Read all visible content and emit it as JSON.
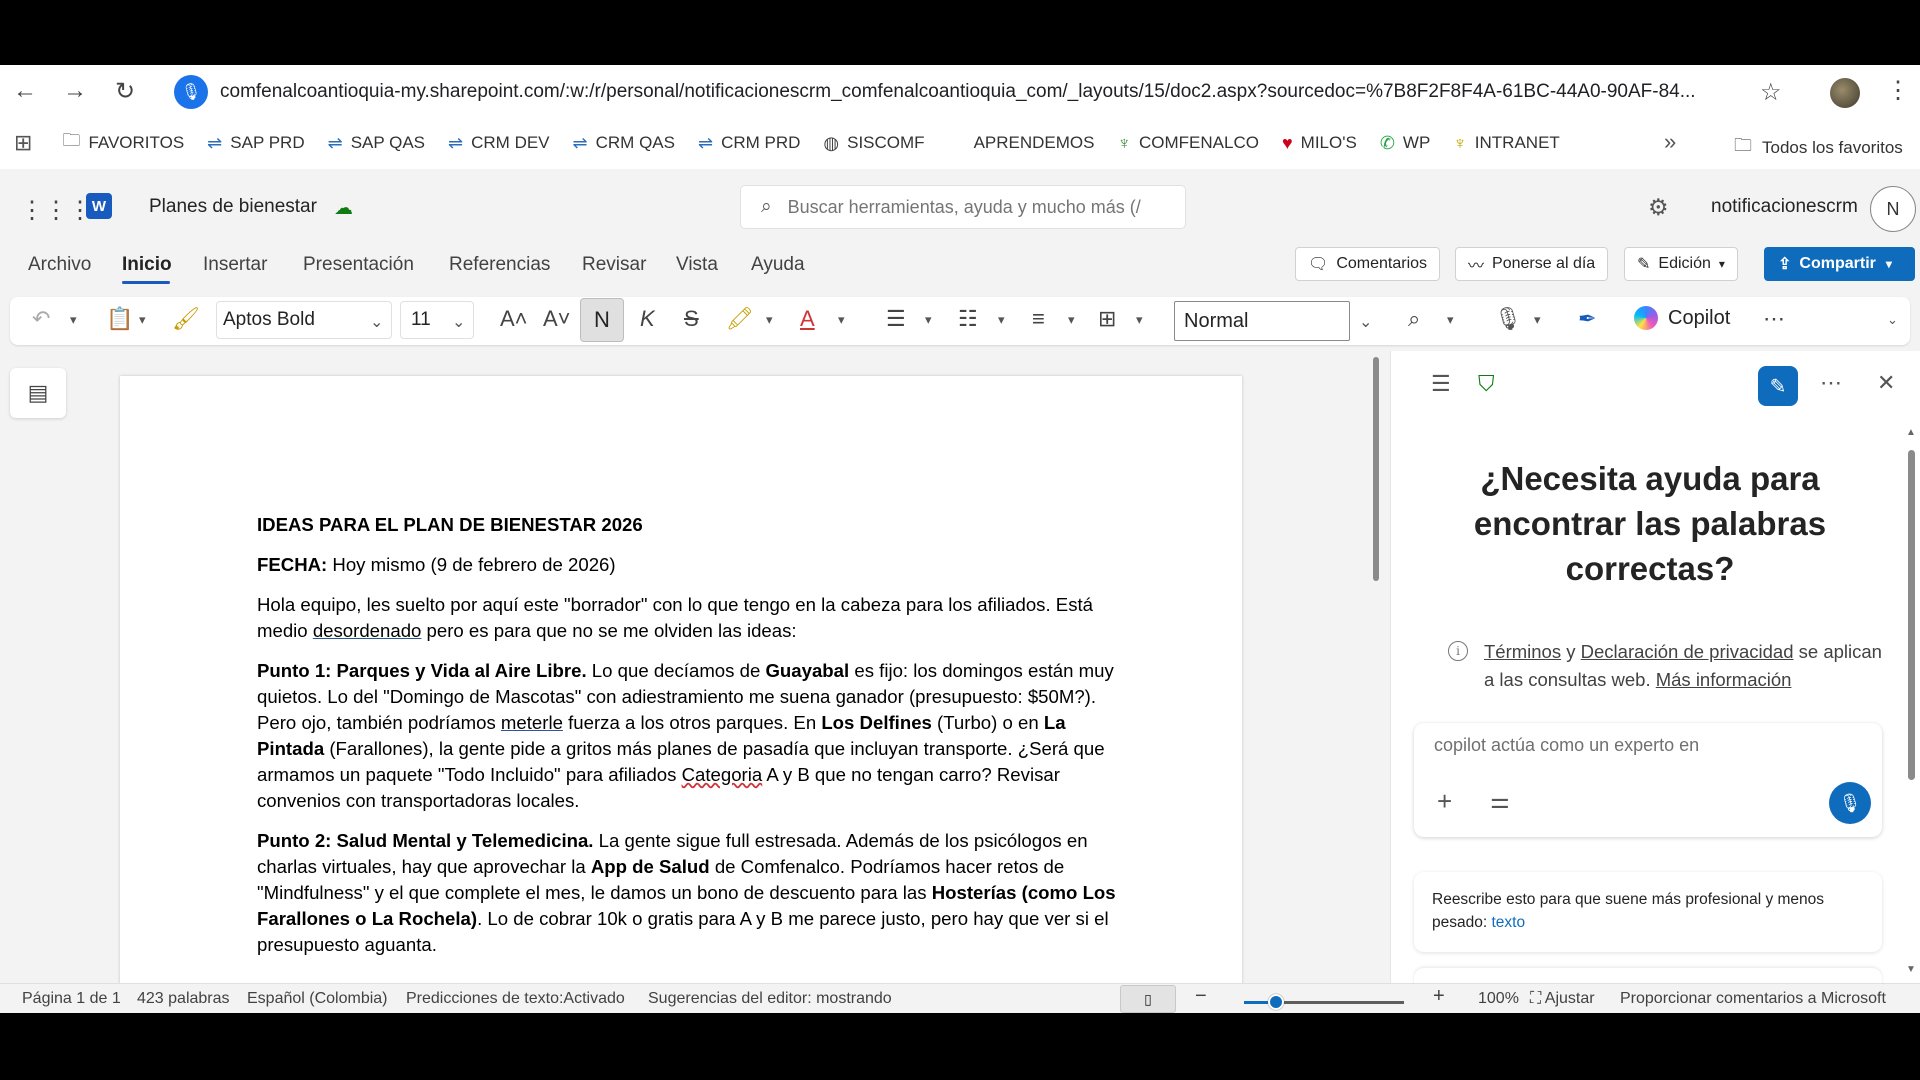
{
  "browser": {
    "url": "comfenalcoantioquia-my.sharepoint.com/:w:/r/personal/notificacionescrm_comfenalcoantioquia_com/_layouts/15/doc2.aspx?sourcedoc=%7B8F2F8F4A-61BC-44A0-90AF-84...",
    "bookmarks": [
      {
        "label": "FAVORITOS",
        "icon": "folder-icon"
      },
      {
        "label": "SAP PRD",
        "icon": "sap-icon"
      },
      {
        "label": "SAP QAS",
        "icon": "sap-icon"
      },
      {
        "label": "CRM DEV",
        "icon": "crm-icon"
      },
      {
        "label": "CRM QAS",
        "icon": "crm-icon"
      },
      {
        "label": "CRM PRD",
        "icon": "crm-icon"
      },
      {
        "label": "SISCOMF",
        "icon": "globe-icon"
      },
      {
        "label": "APRENDEMOS",
        "icon": ""
      },
      {
        "label": "COMFENALCO",
        "icon": "comfenalco-icon"
      },
      {
        "label": "MILO'S",
        "icon": "heart-icon"
      },
      {
        "label": "WP",
        "icon": "whatsapp-icon"
      },
      {
        "label": "INTRANET",
        "icon": "intranet-icon"
      }
    ],
    "all_bookmarks": "Todos los favoritos"
  },
  "word": {
    "doc_title": "Planes de bienestar",
    "search_placeholder": "Buscar herramientas, ayuda y mucho más (/",
    "user": "notificacionescrm",
    "avatar_initial": "N",
    "tabs": [
      "Archivo",
      "Inicio",
      "Insertar",
      "Presentación",
      "Referencias",
      "Revisar",
      "Vista",
      "Ayuda"
    ],
    "active_tab": "Inicio",
    "header_buttons": {
      "comments": "Comentarios",
      "catch_up": "Ponerse al día",
      "editing": "Edición",
      "share": "Compartir"
    },
    "ribbon": {
      "font": "Aptos Bold",
      "size": "11",
      "bold": "N",
      "italic": "K",
      "strike": "S",
      "style": "Normal",
      "copilot": "Copilot"
    }
  },
  "document": {
    "title": "IDEAS PARA EL PLAN DE BIENESTAR 2026",
    "date_label": "FECHA:",
    "date_value": " Hoy mismo (9 de febrero de 2026)",
    "intro_1": "Hola equipo, les suelto por aquí este \"borrador\" con lo que tengo en la cabeza para los afiliados. Está medio ",
    "intro_link": "desordenado",
    "intro_2": " pero es para que no se me olviden las ideas:",
    "p1": {
      "heading": "Punto 1: Parques y Vida al Aire Libre.",
      "t1": " Lo que decíamos de ",
      "b1": "Guayabal",
      "t2": " es fijo: los domingos están muy quietos. Lo del \"Domingo de Mascotas\" con adiestramiento me suena ganador (presupuesto: $50M?). Pero ojo, también podríamos ",
      "u1": "meterle",
      "t3": " fuerza a los otros parques. En ",
      "b2": "Los Delfines",
      "t4": " (Turbo) o en ",
      "b3": "La Pintada",
      "t5": " (Farallones), la gente pide a gritos más planes de pasadía que incluyan transporte. ¿Será que armamos un paquete \"Todo Incluido\" para afiliados ",
      "u2": "Categoria",
      "t6": " A y B que no tengan carro? Revisar convenios con transportadoras locales."
    },
    "p2": {
      "heading": "Punto 2: Salud Mental y Telemedicina.",
      "t1": " La gente sigue full estresada. Además de los psicólogos en charlas virtuales, hay que aprovechar la ",
      "b1": "App de Salud",
      "t2": " de Comfenalco. Podríamos hacer retos de \"Mindfulness\" y el que complete el mes, le damos un bono de descuento para las ",
      "b2": "Hosterías (como Los Farallones o La Rochela)",
      "t3": ". Lo de cobrar 10k o gratis para A y B me parece justo, pero hay que ver si el presupuesto aguanta."
    }
  },
  "copilot": {
    "heading": "¿Necesita ayuda para encontrar las palabras correctas?",
    "terms": "Términos",
    "and": " y ",
    "privacy": "Declaración de privacidad",
    "terms_rest": " se aplican a las consultas web. ",
    "more_info": "Más información",
    "input_value": "copilot actúa como un experto en",
    "suggestion_text": "Reescribe esto para que suene más profesional y menos pesado: ",
    "suggestion_token": "texto"
  },
  "statusbar": {
    "page": "Página 1 de 1",
    "words": "423 palabras",
    "language": "Español (Colombia)",
    "predictions": "Predicciones de texto:Activado",
    "suggestions": "Sugerencias del editor: mostrando",
    "zoom": "100%",
    "fit": "Ajustar",
    "feedback": "Proporcionar comentarios a Microsoft",
    "zoom_fraction": 0.2
  }
}
